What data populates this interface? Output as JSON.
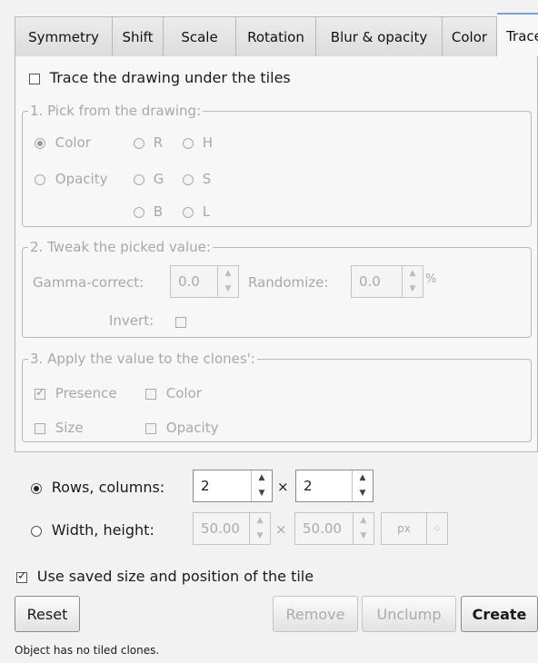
{
  "tabs": [
    {
      "label": "Symmetry"
    },
    {
      "label": "Shift"
    },
    {
      "label": "Scale"
    },
    {
      "label": "Rotation"
    },
    {
      "label": "Blur & opacity"
    },
    {
      "label": "Color"
    },
    {
      "label": "Trace",
      "active": true
    }
  ],
  "trace": {
    "main_checkbox_label": "Trace the drawing under the tiles",
    "main_checkbox_checked": false,
    "pick": {
      "title": "1. Pick from the drawing:",
      "options": {
        "color": "Color",
        "opacity": "Opacity",
        "r": "R",
        "g": "G",
        "b": "B",
        "h": "H",
        "s": "S",
        "l": "L"
      },
      "selected": "Color"
    },
    "tweak": {
      "title": "2. Tweak the picked value:",
      "gamma_label": "Gamma-correct:",
      "gamma_value": "0.0",
      "randomize_label": "Randomize:",
      "randomize_value": "0.0",
      "percent": "%",
      "invert_label": "Invert:",
      "invert_checked": false
    },
    "apply": {
      "title": "3. Apply the value to the clones':",
      "presence": "Presence",
      "presence_checked": true,
      "color": "Color",
      "color_checked": false,
      "size": "Size",
      "size_checked": false,
      "opacity": "Opacity",
      "opacity_checked": false
    }
  },
  "layout_opts": {
    "rows_cols_label": "Rows, columns:",
    "rows_value": "2",
    "cols_value": "2",
    "times": "×",
    "width_height_label": "Width, height:",
    "width_value": "50.00",
    "height_value": "50.00",
    "unit": "px",
    "selected": "Rows, columns"
  },
  "use_saved_label": "Use saved size and position of the tile",
  "use_saved_checked": true,
  "buttons": {
    "reset": "Reset",
    "remove": "Remove",
    "unclump": "Unclump",
    "create": "Create"
  },
  "status": "Object has no tiled clones."
}
